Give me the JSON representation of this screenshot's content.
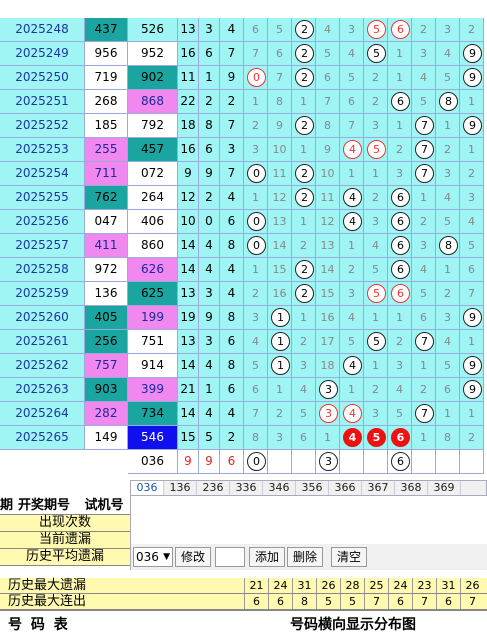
{
  "rows": [
    {
      "period": "2025248",
      "kj": "437",
      "sj": "526",
      "s": [
        "13",
        "3",
        "4"
      ],
      "d": [
        "6",
        "5",
        "2",
        "4",
        "3",
        "5",
        "6",
        "2",
        "3",
        "2"
      ],
      "kjbg": "teal",
      "sjbg": "cyan",
      "balls": {
        "2": "o",
        "5": "r",
        "6": "r"
      }
    },
    {
      "period": "2025249",
      "kj": "956",
      "sj": "952",
      "s": [
        "16",
        "6",
        "7"
      ],
      "d": [
        "7",
        "6",
        "2",
        "5",
        "4",
        "5",
        "1",
        "3",
        "4",
        "9"
      ],
      "kjbg": "white",
      "sjbg": "white",
      "balls": {
        "2": "o",
        "5": "o",
        "9": "o"
      }
    },
    {
      "period": "2025250",
      "kj": "719",
      "sj": "902",
      "s": [
        "11",
        "1",
        "9"
      ],
      "d": [
        "0",
        "7",
        "2",
        "6",
        "5",
        "2",
        "1",
        "4",
        "5",
        "9"
      ],
      "kjbg": "white",
      "sjbg": "teal",
      "balls": {
        "0": "r",
        "2": "o",
        "9": "o"
      }
    },
    {
      "period": "2025251",
      "kj": "268",
      "sj": "868",
      "s": [
        "22",
        "2",
        "2"
      ],
      "d": [
        "1",
        "8",
        "1",
        "7",
        "6",
        "2",
        "6",
        "5",
        "8",
        "1"
      ],
      "kjbg": "white",
      "sjbg": "pink",
      "balls": {
        "6": "o",
        "8": "o"
      }
    },
    {
      "period": "2025252",
      "kj": "185",
      "sj": "792",
      "s": [
        "18",
        "8",
        "7"
      ],
      "d": [
        "2",
        "9",
        "2",
        "8",
        "7",
        "3",
        "1",
        "7",
        "1",
        "9"
      ],
      "kjbg": "white",
      "sjbg": "white",
      "balls": {
        "2": "o",
        "7": "o",
        "9": "o"
      }
    },
    {
      "period": "2025253",
      "kj": "255",
      "sj": "457",
      "s": [
        "16",
        "6",
        "3"
      ],
      "d": [
        "3",
        "10",
        "1",
        "9",
        "4",
        "5",
        "2",
        "7",
        "2",
        "1"
      ],
      "kjbg": "pink",
      "sjbg": "teal",
      "balls": {
        "4": "r",
        "5": "r",
        "7": "o"
      }
    },
    {
      "period": "2025254",
      "kj": "711",
      "sj": "072",
      "s": [
        "9",
        "9",
        "7"
      ],
      "d": [
        "0",
        "11",
        "2",
        "10",
        "1",
        "1",
        "3",
        "7",
        "3",
        "2"
      ],
      "kjbg": "pink",
      "sjbg": "white",
      "balls": {
        "0": "o",
        "2": "o",
        "7": "o"
      }
    },
    {
      "period": "2025255",
      "kj": "762",
      "sj": "264",
      "s": [
        "12",
        "2",
        "4"
      ],
      "d": [
        "1",
        "12",
        "2",
        "11",
        "4",
        "2",
        "6",
        "1",
        "4",
        "3"
      ],
      "kjbg": "teal",
      "sjbg": "white",
      "balls": {
        "2": "o",
        "4": "o",
        "6": "o"
      }
    },
    {
      "period": "2025256",
      "kj": "047",
      "sj": "406",
      "s": [
        "10",
        "0",
        "6"
      ],
      "d": [
        "0",
        "13",
        "1",
        "12",
        "4",
        "3",
        "6",
        "2",
        "5",
        "4"
      ],
      "kjbg": "white",
      "sjbg": "white",
      "balls": {
        "0": "o",
        "4": "o",
        "6": "o"
      }
    },
    {
      "period": "2025257",
      "kj": "411",
      "sj": "860",
      "s": [
        "14",
        "4",
        "8"
      ],
      "d": [
        "0",
        "14",
        "2",
        "13",
        "1",
        "4",
        "6",
        "3",
        "8",
        "5"
      ],
      "kjbg": "pink",
      "sjbg": "white",
      "balls": {
        "0": "o",
        "6": "o",
        "8": "o"
      }
    },
    {
      "period": "2025258",
      "kj": "972",
      "sj": "626",
      "s": [
        "14",
        "4",
        "4"
      ],
      "d": [
        "1",
        "15",
        "2",
        "14",
        "2",
        "5",
        "6",
        "4",
        "1",
        "6"
      ],
      "kjbg": "white",
      "sjbg": "pink",
      "balls": {
        "2": "o",
        "6": "o"
      }
    },
    {
      "period": "2025259",
      "kj": "136",
      "sj": "625",
      "s": [
        "13",
        "3",
        "4"
      ],
      "d": [
        "2",
        "16",
        "2",
        "15",
        "3",
        "5",
        "6",
        "5",
        "2",
        "7"
      ],
      "kjbg": "white",
      "sjbg": "teal",
      "balls": {
        "2": "o",
        "5": "r",
        "6": "r"
      }
    },
    {
      "period": "2025260",
      "kj": "405",
      "sj": "199",
      "s": [
        "19",
        "9",
        "8"
      ],
      "d": [
        "3",
        "1",
        "1",
        "16",
        "4",
        "1",
        "1",
        "6",
        "3",
        "9"
      ],
      "kjbg": "teal",
      "sjbg": "pink",
      "balls": {
        "1": "o",
        "9": "o"
      }
    },
    {
      "period": "2025261",
      "kj": "256",
      "sj": "751",
      "s": [
        "13",
        "3",
        "6"
      ],
      "d": [
        "4",
        "1",
        "2",
        "17",
        "5",
        "5",
        "2",
        "7",
        "4",
        "1"
      ],
      "kjbg": "teal",
      "sjbg": "white",
      "balls": {
        "1": "o",
        "5": "o",
        "7": "o"
      }
    },
    {
      "period": "2025262",
      "kj": "757",
      "sj": "914",
      "s": [
        "14",
        "4",
        "8"
      ],
      "d": [
        "5",
        "1",
        "3",
        "18",
        "4",
        "1",
        "3",
        "1",
        "5",
        "9"
      ],
      "kjbg": "pink",
      "sjbg": "white",
      "balls": {
        "1": "o",
        "4": "o",
        "9": "o"
      }
    },
    {
      "period": "2025263",
      "kj": "903",
      "sj": "399",
      "s": [
        "21",
        "1",
        "6"
      ],
      "d": [
        "6",
        "1",
        "4",
        "3",
        "1",
        "2",
        "4",
        "2",
        "6",
        "9"
      ],
      "kjbg": "teal",
      "sjbg": "pink",
      "balls": {
        "3": "o",
        "9": "o"
      }
    },
    {
      "period": "2025264",
      "kj": "282",
      "sj": "734",
      "s": [
        "14",
        "4",
        "4"
      ],
      "d": [
        "7",
        "2",
        "5",
        "3",
        "4",
        "3",
        "5",
        "7",
        "1",
        "1"
      ],
      "kjbg": "pink",
      "sjbg": "teal",
      "balls": {
        "3": "r",
        "4": "r",
        "7": "o"
      }
    },
    {
      "period": "2025265",
      "kj": "149",
      "sj": "546",
      "s": [
        "15",
        "5",
        "2"
      ],
      "d": [
        "8",
        "3",
        "6",
        "1",
        "4",
        "5",
        "6",
        "1",
        "8",
        "2"
      ],
      "kjbg": "white",
      "sjbg": "blue",
      "balls": {
        "4": "f",
        "5": "f",
        "6": "f"
      }
    }
  ],
  "summary": {
    "sj": "036",
    "s": [
      "9",
      "9",
      "6"
    ],
    "d": [
      "0",
      "",
      "",
      "3",
      "",
      "",
      "6",
      "",
      "",
      ""
    ]
  },
  "tabs": [
    "036",
    "136",
    "236",
    "336",
    "346",
    "356",
    "366",
    "367",
    "368",
    "369"
  ],
  "toolbar": {
    "select_value": "036",
    "edit": "修改",
    "add": "添加",
    "delete": "删除",
    "clear": "清空"
  },
  "left_header": {
    "c1": "期",
    "c2": "开奖期号",
    "c3": "试机号"
  },
  "left_rows": [
    "出现次数",
    "当前遗漏",
    "历史平均遗漏"
  ],
  "bottom_rows": [
    {
      "label": "历史最大遗漏",
      "values": [
        "21",
        "24",
        "31",
        "26",
        "28",
        "25",
        "24",
        "23",
        "31",
        "26"
      ]
    },
    {
      "label": "历史最大连出",
      "values": [
        "6",
        "6",
        "8",
        "5",
        "5",
        "7",
        "6",
        "7",
        "6",
        "7"
      ]
    }
  ],
  "footer": {
    "left": "号 码 表",
    "right": "号码横向显示分布图"
  }
}
